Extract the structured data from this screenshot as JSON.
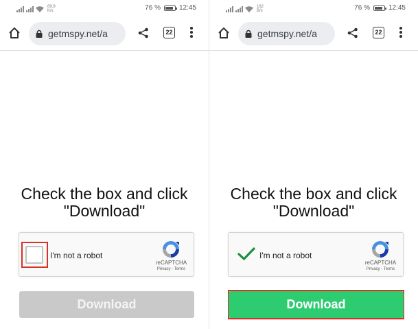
{
  "screens": [
    {
      "status": {
        "speed_value": "89.9",
        "speed_unit": "K/s",
        "battery": "76 %",
        "battery_level": 0.76,
        "time": "12:45"
      },
      "url": "getmspy.net/a",
      "tab_count": "22",
      "heading_line1": "Check the box and click",
      "heading_line2": "\"Download\"",
      "captcha": {
        "label": "I'm not a robot",
        "brand": "reCAPTCHA",
        "links": "Privacy - Terms",
        "checked": false
      },
      "download_label": "Download",
      "download_state": "disabled"
    },
    {
      "status": {
        "speed_value": "182",
        "speed_unit": "B/s",
        "battery": "76 %",
        "battery_level": 0.76,
        "time": "12:45"
      },
      "url": "getmspy.net/a",
      "tab_count": "22",
      "heading_line1": "Check the box and click",
      "heading_line2": "\"Download\"",
      "captcha": {
        "label": "I'm not a robot",
        "brand": "reCAPTCHA",
        "links": "Privacy - Terms",
        "checked": true
      },
      "download_label": "Download",
      "download_state": "enabled"
    }
  ],
  "colors": {
    "accent_green": "#2ecc71",
    "highlight_red": "#d93025",
    "disabled_gray": "#c9c9c9",
    "check_green": "#1e8e3e"
  }
}
